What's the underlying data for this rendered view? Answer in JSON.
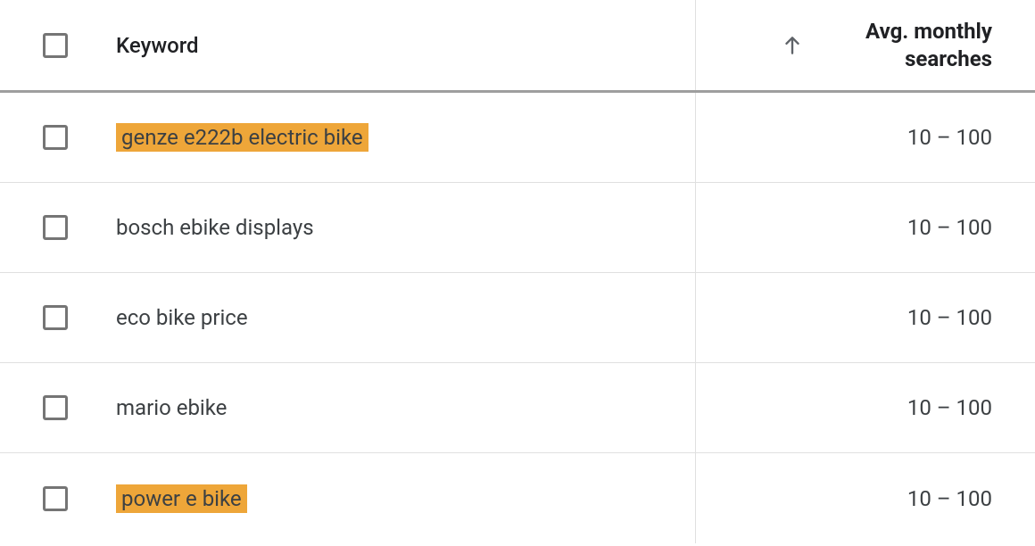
{
  "table": {
    "columns": {
      "keyword": "Keyword",
      "searches_line1": "Avg. monthly",
      "searches_line2": "searches"
    },
    "rows": [
      {
        "keyword": "genze e222b electric bike",
        "highlighted": true,
        "searches": "10 – 100"
      },
      {
        "keyword": "bosch ebike displays",
        "highlighted": false,
        "searches": "10 – 100"
      },
      {
        "keyword": "eco bike price",
        "highlighted": false,
        "searches": "10 – 100"
      },
      {
        "keyword": "mario ebike",
        "highlighted": false,
        "searches": "10 – 100"
      },
      {
        "keyword": "power e bike",
        "highlighted": true,
        "searches": "10 – 100"
      }
    ]
  }
}
